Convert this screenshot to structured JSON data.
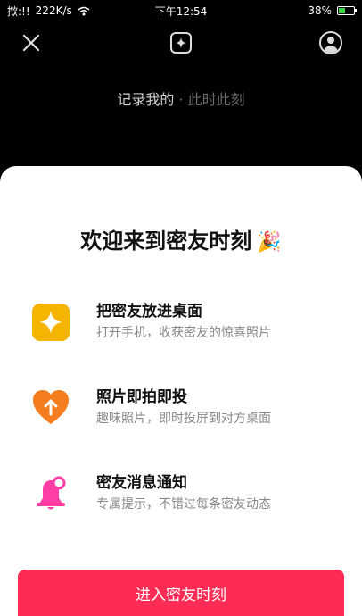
{
  "status_bar": {
    "carrier": "揿:!!",
    "speed": "222K/s",
    "time": "下午12:54",
    "battery": "38%",
    "battery_level": 0.38
  },
  "top_bar": {
    "close_icon": "close-icon",
    "center_icon": "sparkle-icon",
    "profile_icon": "avatar-icon"
  },
  "record_caption": {
    "main": "记录我的",
    "dim": "· 此时此刻"
  },
  "sheet": {
    "welcome": "欢迎来到密友时刻",
    "welcome_emoji": "🎉",
    "features": [
      {
        "title": "把密友放进桌面",
        "desc": "打开手机，收获密友的惊喜照片",
        "icon": "sparkle-icon",
        "color": "#f5b400"
      },
      {
        "title": "照片即拍即投",
        "desc": "趣味照片，即时投屏到对方桌面",
        "icon": "heart-upload-icon",
        "color": "#f47d20"
      },
      {
        "title": "密友消息通知",
        "desc": "专属提示，不错过每条密友动态",
        "icon": "bell-icon",
        "color": "#ff3ea5"
      }
    ],
    "cta_label": "进入密友时刻",
    "cta_color": "#fe2c55"
  }
}
